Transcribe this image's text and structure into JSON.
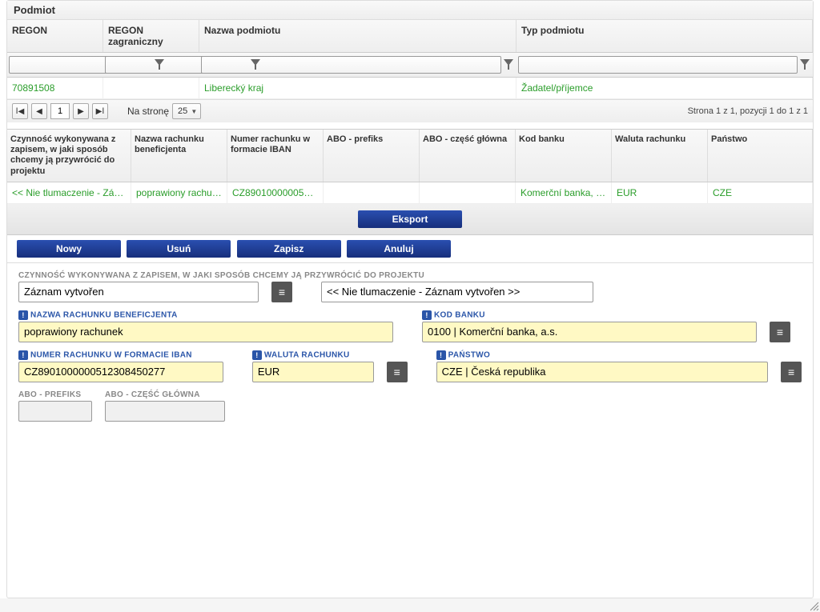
{
  "panel_title": "Podmiot",
  "grid1": {
    "headers": {
      "regon": "REGON",
      "regon_z": "REGON zagraniczny",
      "nazwa": "Nazwa podmiotu",
      "typ": "Typ podmiotu"
    },
    "row": {
      "regon": "70891508",
      "regon_z": "",
      "nazwa": "Liberecký kraj",
      "typ": "Žadatel/příjemce"
    }
  },
  "pager": {
    "page": "1",
    "per_label": "Na stronę",
    "per_value": "25",
    "summary": "Strona 1 z 1, pozycji 1 do 1 z 1"
  },
  "grid2": {
    "headers": {
      "czynnosc": "Czynność wykonywana z zapisem, w jaki sposób chcemy ją przywrócić do projektu",
      "nazwa_rach": "Nazwa rachunku beneficjenta",
      "iban": "Numer rachunku w formacie IBAN",
      "abo_p": "ABO - prefiks",
      "abo_g": "ABO - część główna",
      "kod": "Kod banku",
      "waluta": "Waluta rachunku",
      "panstwo": "Państwo"
    },
    "row": {
      "czynnosc": "<< Nie tlumaczenie - Zázn...",
      "nazwa_rach": "poprawiony rachun...",
      "iban": "CZ8901000000512...",
      "abo_p": "",
      "abo_g": "",
      "kod": "Komerční banka, a.s.",
      "waluta": "EUR",
      "panstwo": "CZE"
    }
  },
  "buttons": {
    "eksport": "Eksport",
    "nowy": "Nowy",
    "usun": "Usuń",
    "zapisz": "Zapisz",
    "anuluj": "Anuluj"
  },
  "form": {
    "section_label": "CZYNNOŚĆ WYKONYWANA Z ZAPISEM, W JAKI SPOSÓB CHCEMY JĄ PRZYWRÓCIĆ DO PROJEKTU",
    "czynnosc_value": "Záznam vytvořen",
    "czynnosc_readonly": "<< Nie tlumaczenie - Záznam vytvořen >>",
    "nazwa_label": "NAZWA RACHUNKU BENEFICJENTA",
    "nazwa_value": "poprawiony rachunek",
    "kod_label": "KOD BANKU",
    "kod_value": "0100 | Komerční banka, a.s.",
    "iban_label": "NUMER RACHUNKU W FORMACIE IBAN",
    "iban_value": "CZ8901000000512308450277",
    "waluta_label": "WALUTA RACHUNKU",
    "waluta_value": "EUR",
    "panstwo_label": "PAŃSTWO",
    "panstwo_value": "CZE | Česká republika",
    "abo_p_label": "ABO - PREFIKS",
    "abo_g_label": "ABO - CZĘŚĆ GŁÓWNA",
    "req_mark": "!"
  }
}
